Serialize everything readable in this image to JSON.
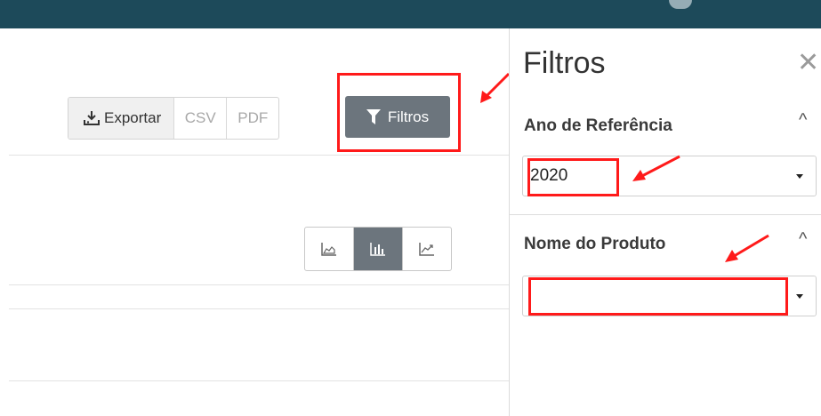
{
  "toolbar": {
    "exportar_label": "Exportar",
    "csv_label": "CSV",
    "pdf_label": "PDF",
    "filtros_label": "Filtros"
  },
  "panel": {
    "title": "Filtros",
    "close_glyph": "✕",
    "sections": [
      {
        "label": "Ano de Referência",
        "value": "2020",
        "expand_glyph": "^"
      },
      {
        "label": "Nome do Produto",
        "value": "",
        "expand_glyph": "^"
      }
    ]
  },
  "chart_types": [
    "area-chart-icon",
    "bar-chart-icon",
    "line-chart-icon"
  ],
  "colors": {
    "topbar": "#1d4a5a",
    "primary_button": "#6c757d",
    "annotation_red": "#ff1a1a"
  }
}
